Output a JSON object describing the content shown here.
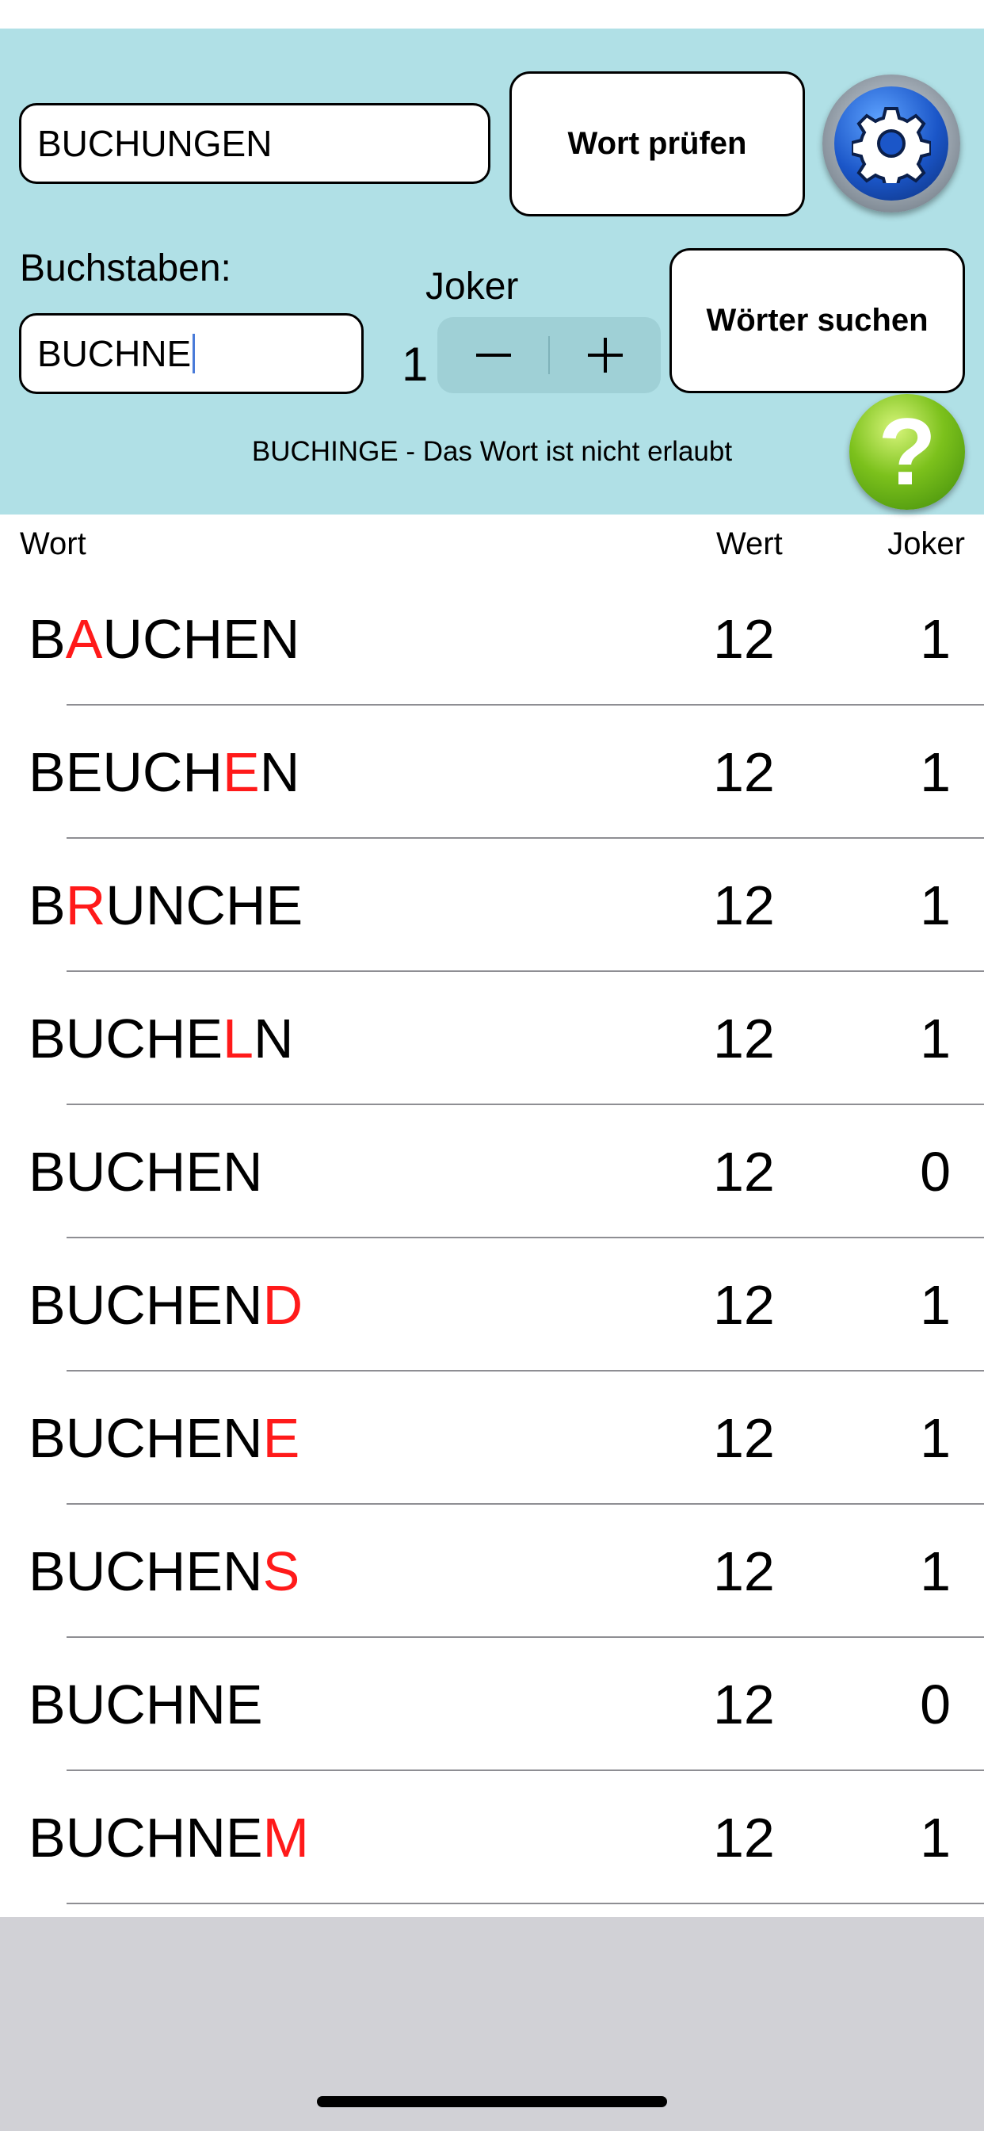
{
  "word_check": {
    "input_value": "BUCHUNGEN",
    "button_label": "Wort prüfen"
  },
  "settings": {
    "icon": "gear-icon"
  },
  "letters": {
    "label": "Buchstaben:",
    "input_value": "BUCHNE"
  },
  "joker": {
    "label": "Joker",
    "count": "1",
    "decrement_symbol": "−",
    "increment_symbol": "+"
  },
  "search": {
    "button_label": "Wörter suchen"
  },
  "help": {
    "icon": "question-mark-icon",
    "symbol": "?"
  },
  "status_message": "BUCHINGE - Das Wort ist nicht erlaubt",
  "table": {
    "headers": {
      "word": "Wort",
      "value": "Wert",
      "joker": "Joker"
    },
    "rows": [
      {
        "word": "BAUCHEN",
        "joker_index": 1,
        "value": "12",
        "jokers": "1"
      },
      {
        "word": "BEUCHEN",
        "joker_index": 5,
        "value": "12",
        "jokers": "1"
      },
      {
        "word": "BRUNCHE",
        "joker_index": 1,
        "value": "12",
        "jokers": "1"
      },
      {
        "word": "BUCHELN",
        "joker_index": 5,
        "value": "12",
        "jokers": "1"
      },
      {
        "word": "BUCHEN",
        "joker_index": -1,
        "value": "12",
        "jokers": "0"
      },
      {
        "word": "BUCHEND",
        "joker_index": 6,
        "value": "12",
        "jokers": "1"
      },
      {
        "word": "BUCHENE",
        "joker_index": 6,
        "value": "12",
        "jokers": "1"
      },
      {
        "word": "BUCHENS",
        "joker_index": 6,
        "value": "12",
        "jokers": "1"
      },
      {
        "word": "BUCHNE",
        "joker_index": -1,
        "value": "12",
        "jokers": "0"
      },
      {
        "word": "BUCHNEM",
        "joker_index": 6,
        "value": "12",
        "jokers": "1"
      }
    ]
  },
  "colors": {
    "panel_background": "#b0e0e6",
    "joker_letter": "#ff1a1a",
    "bottom_area": "#d1d1d6"
  }
}
